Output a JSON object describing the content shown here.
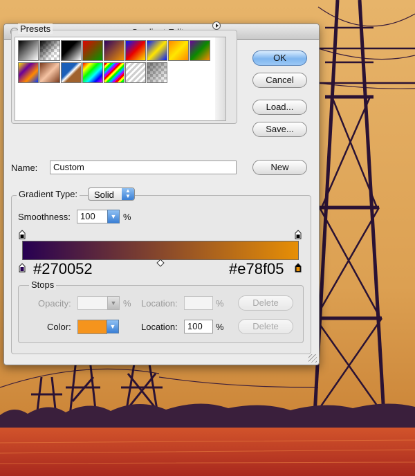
{
  "window": {
    "title": "Gradient Editor"
  },
  "presets": {
    "label": "Presets",
    "menu_icon": "flyout-menu-icon",
    "swatches": [
      {
        "name": "foreground-to-background",
        "css": "linear-gradient(135deg,#000,#fff)"
      },
      {
        "name": "foreground-to-transparent",
        "css": "linear-gradient(135deg,#000 0%,rgba(0,0,0,0) 70%), repeating-conic-gradient(#ccc 0% 25%, #fff 0% 50%) 0 0/8px 8px"
      },
      {
        "name": "black-white",
        "css": "linear-gradient(135deg,#000 40%,#fff)"
      },
      {
        "name": "red-green",
        "css": "linear-gradient(135deg,#e10000,#009a00)"
      },
      {
        "name": "violet-orange",
        "css": "linear-gradient(135deg,#2d0063,#f29500)"
      },
      {
        "name": "blue-red-yellow",
        "css": "linear-gradient(135deg,#0018ff,#e80000,#ffe600)"
      },
      {
        "name": "blue-yellow-blue",
        "css": "linear-gradient(135deg,#0018ff,#ffe600,#0018ff)"
      },
      {
        "name": "orange-yellow-orange",
        "css": "linear-gradient(135deg,#ff8800,#ffe600,#ff8800)"
      },
      {
        "name": "violet-green-orange",
        "css": "linear-gradient(135deg,#6b0099,#0a8a00,#ff8a00)"
      },
      {
        "name": "yellow-violet-orange-blue",
        "css": "linear-gradient(135deg,#ffe600,#6b0099,#ff8a00,#0036ff)"
      },
      {
        "name": "copper",
        "css": "linear-gradient(135deg,#7a3a1c,#f5c3a3,#7a3a1c)"
      },
      {
        "name": "chrome",
        "css": "linear-gradient(135deg,#1b5fb8 40%,#fff 50%,#a0622d 60%)"
      },
      {
        "name": "spectrum",
        "css": "linear-gradient(135deg,#ff0000,#ffff00,#00ff00,#00ffff,#0000ff,#ff00ff)"
      },
      {
        "name": "transparent-rainbow",
        "css": "repeating-linear-gradient(135deg,#ff0000 0 3px,#ffff00 3px 6px,#00ff00 6px 9px,#00aaff 9px 12px,#aa00ff 12px 15px)"
      },
      {
        "name": "transparent-stripes",
        "css": "repeating-linear-gradient(135deg,#cfcfcf 0 3px,#ffffff 3px 6px)"
      },
      {
        "name": "neutral-density",
        "css": "linear-gradient(135deg,rgba(0,0,0,0.5),rgba(0,0,0,0)), repeating-conic-gradient(#ccc 0% 25%, #fff 0% 50%) 0 0/8px 8px"
      }
    ]
  },
  "buttons": {
    "ok": "OK",
    "cancel": "Cancel",
    "load": "Load...",
    "save": "Save...",
    "new": "New"
  },
  "name": {
    "label": "Name:",
    "value": "Custom"
  },
  "gradient": {
    "type_label": "Gradient Type:",
    "type_value": "Solid",
    "smoothness_label": "Smoothness:",
    "smoothness_value": "100",
    "smoothness_unit": "%",
    "start_color": "#270052",
    "end_color": "#e78f05",
    "start_hex_label": "#270052",
    "end_hex_label": "#e78f05"
  },
  "stops": {
    "label": "Stops",
    "opacity_label": "Opacity:",
    "opacity_value": "",
    "opacity_unit": "%",
    "opacity_location_label": "Location:",
    "opacity_location_value": "",
    "opacity_location_unit": "%",
    "opacity_delete": "Delete",
    "color_label": "Color:",
    "color_value": "#f5941d",
    "color_location_label": "Location:",
    "color_location_value": "100",
    "color_location_unit": "%",
    "color_delete": "Delete"
  }
}
